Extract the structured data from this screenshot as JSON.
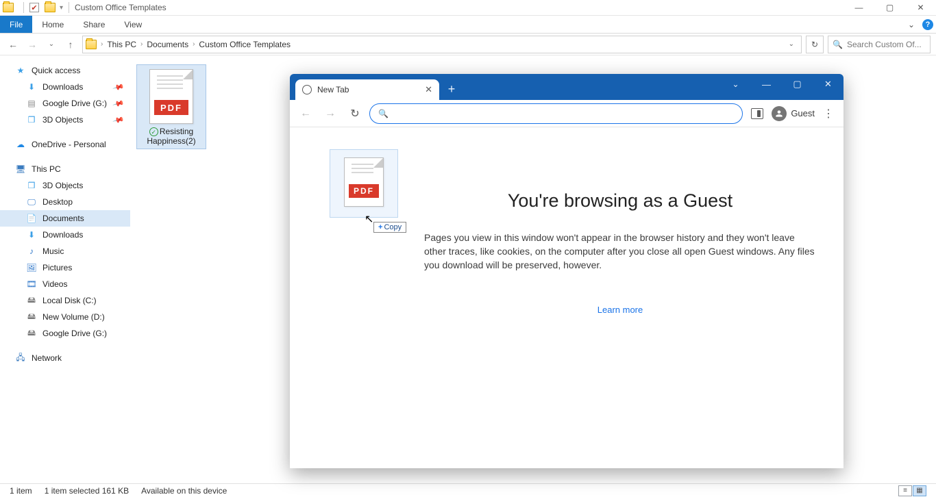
{
  "titlebar": {
    "title": "Custom Office Templates"
  },
  "ribbon": {
    "file": "File",
    "home": "Home",
    "share": "Share",
    "view": "View"
  },
  "breadcrumb": {
    "seg1": "This PC",
    "seg2": "Documents",
    "seg3": "Custom Office Templates"
  },
  "search": {
    "placeholder": "Search Custom Of..."
  },
  "sidebar": {
    "quick_access": "Quick access",
    "downloads": "Downloads",
    "gdrive": "Google Drive (G:)",
    "objects3d": "3D Objects",
    "onedrive": "OneDrive - Personal",
    "this_pc": "This PC",
    "pc_3d": "3D Objects",
    "pc_desktop": "Desktop",
    "pc_documents": "Documents",
    "pc_downloads": "Downloads",
    "pc_music": "Music",
    "pc_pictures": "Pictures",
    "pc_videos": "Videos",
    "pc_localc": "Local Disk (C:)",
    "pc_newvol": "New Volume (D:)",
    "pc_gdrive": "Google Drive (G:)",
    "network": "Network"
  },
  "file": {
    "name_l1": "Resisting",
    "name_l2": "Happiness(2)",
    "pdf_label": "PDF"
  },
  "status": {
    "items": "1 item",
    "selected": "1 item selected  161 KB",
    "available": "Available on this device"
  },
  "chrome": {
    "tab_title": "New Tab",
    "guest": "Guest",
    "heading": "You're browsing as a Guest",
    "body": "Pages you view in this window won't appear in the browser history and they won't leave other traces, like cookies, on the computer after you close all open Guest windows. Any files you download will be preserved, however.",
    "learn": "Learn more",
    "copy_badge": "Copy",
    "drag_pdf_label": "PDF"
  }
}
